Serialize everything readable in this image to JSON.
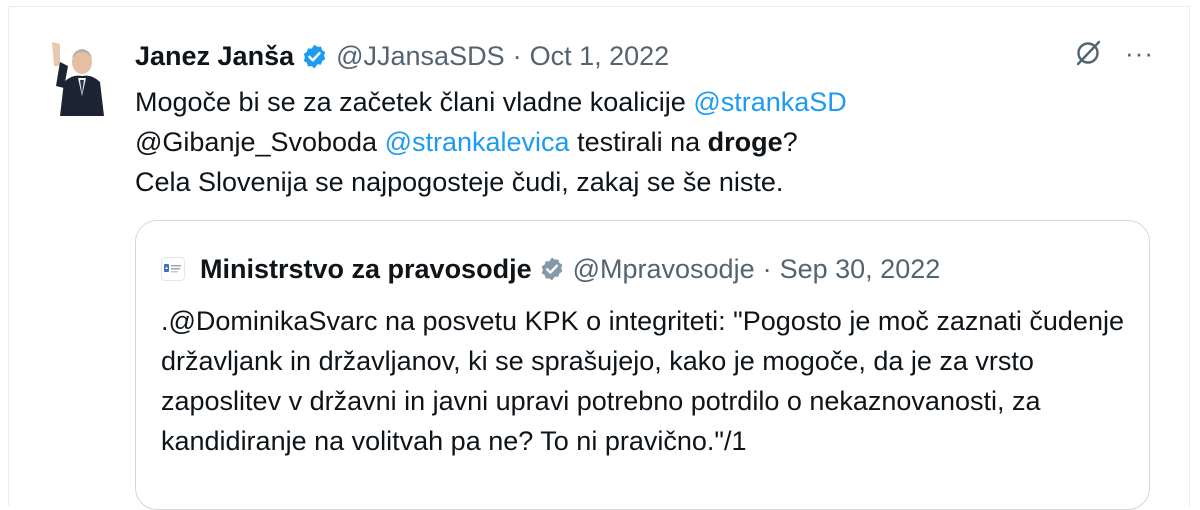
{
  "tweet": {
    "author_name": "Janez Janša",
    "handle": "@JJansaSDS",
    "separator": "·",
    "date": "Oct 1, 2022",
    "more_label": "···",
    "text": {
      "line1_prefix": "Mogoče bi se za začetek člani vladne koalicije ",
      "mention_stranka_sd": "@strankaSD",
      "line2_plain_mention": "@Gibanje_Svoboda",
      "space1": " ",
      "mention_levica": "@strankalevica",
      "line2_middle": " testirali na ",
      "bold_word": "droge",
      "line2_end": "?",
      "line3": "Cela Slovenija se najpogosteje čudi, zakaj se še niste."
    }
  },
  "quote": {
    "author_name": "Ministrstvo za pravosodje",
    "handle": "@Mpravosodje",
    "separator": "·",
    "date": "Sep 30, 2022",
    "text": ".@DominikaSvarc na posvetu KPK o integriteti: \"Pogosto je moč zaznati čudenje državljank in državljanov, ki se sprašujejo, kako je mogoče, da je za vrsto zaposlitev v državni in javni upravi potrebno potrdilo o nekaznovanosti, za kandidiranje na volitvah pa ne? To ni pravično.\"/1"
  },
  "colors": {
    "link": "#1d9bf0",
    "verified_blue": "#1d9bf0",
    "verified_gray": "#829aab",
    "secondary_text": "#536471",
    "border": "#cfd9de"
  },
  "icons": {
    "verified": "verified-badge-icon",
    "grok": "grok-icon",
    "more": "more-icon"
  }
}
